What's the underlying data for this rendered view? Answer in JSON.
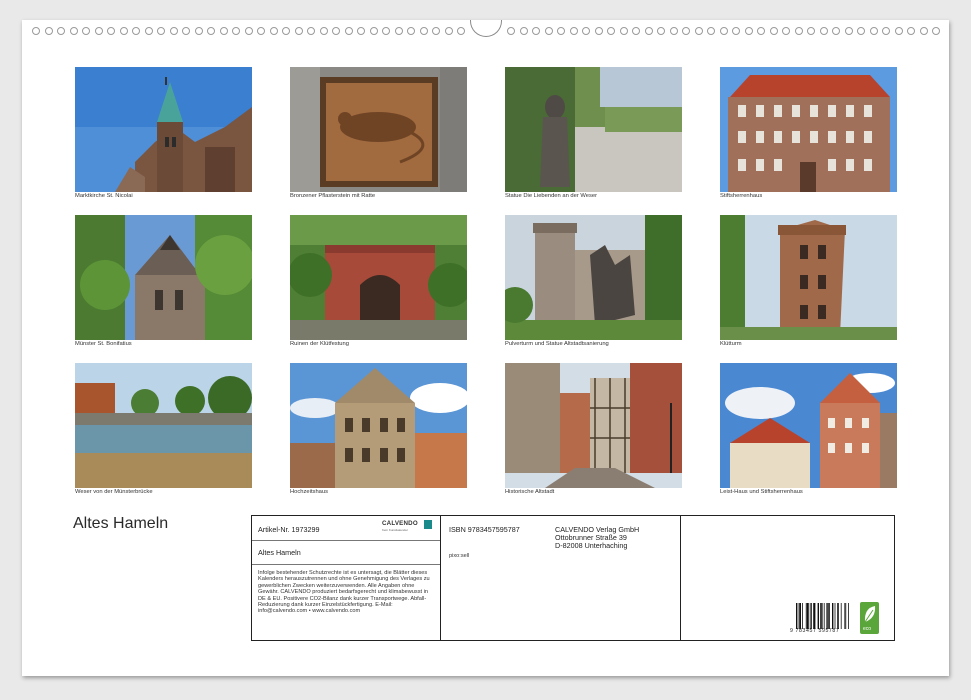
{
  "calendar": {
    "title": "Altes Hameln",
    "photos": [
      {
        "caption": "Marktkirche St. Nicolai"
      },
      {
        "caption": "Bronzener Pflasterstein mit Ratte"
      },
      {
        "caption": "Statue Die Liebenden an der Weser"
      },
      {
        "caption": "Stiftsherrenhaus"
      },
      {
        "caption": "Münster St. Bonifatius"
      },
      {
        "caption": "Ruinen der Klütfestung"
      },
      {
        "caption": "Pulverturm und Statue Altstadtsanierung"
      },
      {
        "caption": "Klütturm"
      },
      {
        "caption": "Weser von der Münsterbrücke"
      },
      {
        "caption": "Hochzeitshaus"
      },
      {
        "caption": "Historische Altstadt"
      },
      {
        "caption": "Leist-Haus und Stiftsherrenhaus"
      }
    ]
  },
  "info": {
    "article": "Artikel-Nr. 1973299",
    "publisher_logo": "CALVENDO",
    "publisher_logo_sub": "Kein Kunstkalender",
    "calendar_title": "Altes Hameln",
    "legal_text": "Infolge bestehender Schutzrechte ist es untersagt, die Blätter dieses Kalenders herauszutrennen und ohne Genehmigung des Verlages zu gewerblichen Zwecken weiterzuverwenden. Alle Angaben ohne Gewähr. CALVENDO produziert bedarfsgerecht und klimabewusst in DE & EU. Positivere CO2-Bilanz dank kurzer Transportwege. Abfall-Reduzierung dank kurzer Einzelstückfertigung. E-Mail: info@calvendo.com • www.calvendo.com",
    "isbn": "ISBN 9783457595787",
    "publisher_name": "CALVENDO Verlag GmbH",
    "publisher_street": "Ottobrunner Straße 39",
    "publisher_city": "D-82008 Unterhaching",
    "printer_code": "pixo:sell",
    "barcode_number": "9 783457 595787",
    "eco_label": "eco"
  },
  "colors": {
    "border": "#222222",
    "eco_green": "#5ba63a",
    "page_bg": "#ffffff"
  }
}
